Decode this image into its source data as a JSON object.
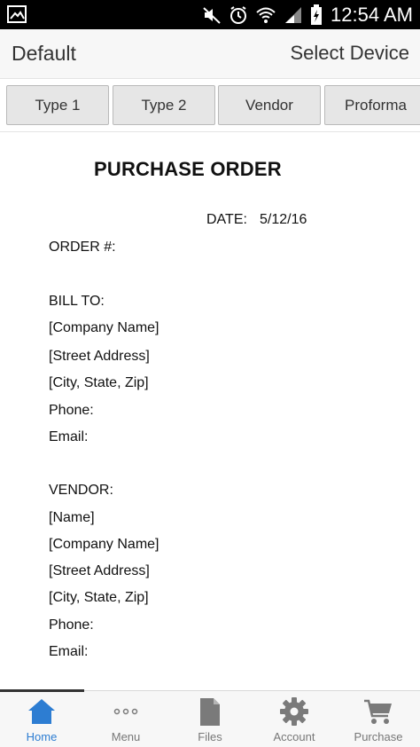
{
  "status_bar": {
    "time": "12:54 AM",
    "icons": [
      "image-icon",
      "mute-icon",
      "alarm-icon",
      "wifi-icon",
      "signal-icon",
      "battery-icon"
    ]
  },
  "header": {
    "title": "Default",
    "select_device": "Select Device"
  },
  "tabs": [
    {
      "label": "Type 1"
    },
    {
      "label": "Type 2"
    },
    {
      "label": "Vendor"
    },
    {
      "label": "Proforma"
    }
  ],
  "document": {
    "title": "PURCHASE ORDER",
    "date_label": "DATE:",
    "date_value": "5/12/16",
    "order_label": "ORDER #:",
    "bill_to": {
      "heading": "BILL TO:",
      "lines": [
        "[Company Name]",
        "[Street Address]",
        "[City, State,  Zip]",
        "Phone:",
        "Email:"
      ]
    },
    "vendor": {
      "heading": "VENDOR:",
      "lines": [
        "[Name]",
        "[Company Name]",
        "[Street Address]",
        "[City, State,  Zip]",
        "Phone:",
        "Email:"
      ]
    }
  },
  "bottom_nav": {
    "active": "Home",
    "items": [
      {
        "label": "Home",
        "icon": "home-icon"
      },
      {
        "label": "Menu",
        "icon": "more-dots-icon"
      },
      {
        "label": "Files",
        "icon": "file-icon"
      },
      {
        "label": "Account",
        "icon": "gear-icon"
      },
      {
        "label": "Purchase",
        "icon": "cart-icon"
      }
    ]
  },
  "colors": {
    "accent": "#2d7dd2",
    "status_bar": "#000000",
    "tab_bg": "#e6e6e6",
    "nav_icon": "#7a7a7a"
  }
}
